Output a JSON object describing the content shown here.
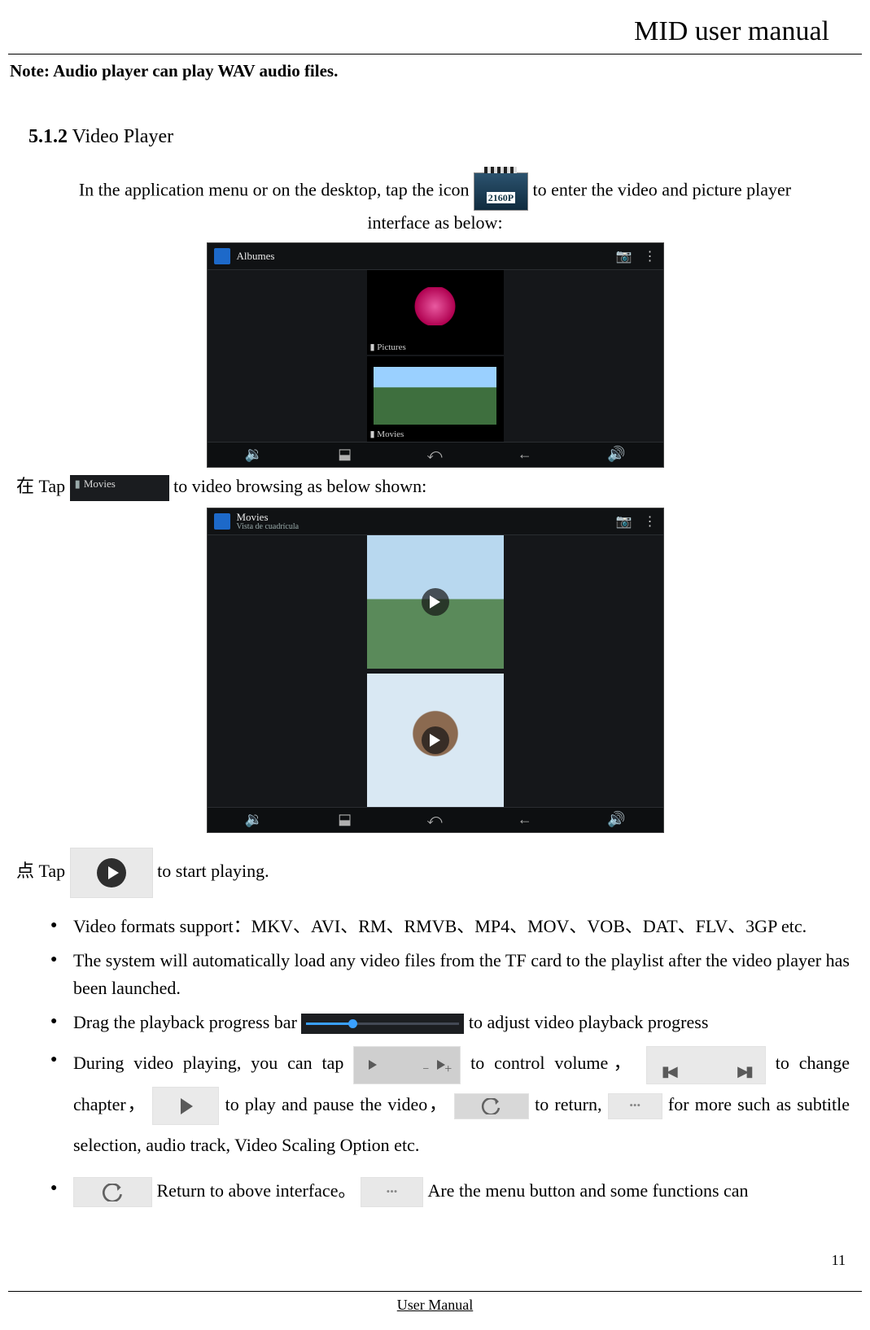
{
  "header": {
    "title": "MID user manual"
  },
  "note_line": "Note: Audio player can play WAV audio files.",
  "section": {
    "number": "5.1.2",
    "title": " Video Player"
  },
  "p1_a": "In the application menu or on the desktop, tap the icon ",
  "p1_b": " to enter the video and picture player",
  "p1_c": "interface as below:",
  "icon_2160": "2160P",
  "ss1": {
    "top_title": "Albumes",
    "cap_pic": "▮ Pictures",
    "cap_mov": "▮ Movies",
    "nav": {
      "a": "🔉",
      "b": "⬓",
      "c": "⤺",
      "d": "←",
      "e": "🔊"
    },
    "cam": "📷",
    "menu": "⋮"
  },
  "p2_a": "在 Tap ",
  "p2_btn": "Movies",
  "p2_b": "to video browsing as below shown:",
  "ss2": {
    "top_a": "Movies",
    "top_b": "Vista de cuadrícula"
  },
  "p3_a": "点 Tap ",
  "p3_b": "to start playing.",
  "bullets": {
    "b1": "Video formats support：MKV、AVI、RM、RMVB、MP4、MOV、VOB、DAT、FLV、3GP etc.",
    "b2": "The system will automatically load any video files from the TF card to the playlist after the video player has been launched.",
    "b3_a": "Drag the playback progress bar ",
    "b3_b": " to adjust video playback progress",
    "b4_a": "During video playing, you can tap",
    "b4_b": " to control volume，",
    "b4_c": "to change chapter，",
    "b4_d": " to play and pause the video，",
    "b4_e": "to return,",
    "b4_f": " for more such as subtitle selection, audio track, Video Scaling Option etc.",
    "b5_a": "Return to above interface。",
    "b5_b": " Are the menu button and some functions can",
    "more_dots": "•••"
  },
  "page_number": "11",
  "footer": "User Manual"
}
